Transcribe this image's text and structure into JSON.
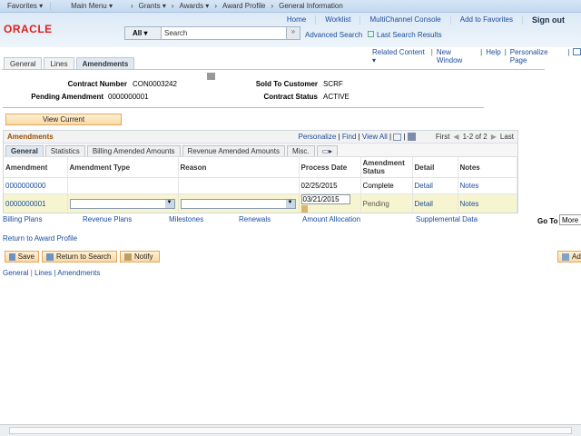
{
  "nav": {
    "favorites": "Favorites ▾",
    "main_menu": "Main Menu ▾",
    "crumbs": [
      "Grants ▾",
      "Awards ▾",
      "Award Profile",
      "General Information"
    ]
  },
  "header": {
    "logo": "ORACLE",
    "links": [
      "Home",
      "Worklist",
      "MultiChannel Console",
      "Add to Favorites",
      "Sign out"
    ],
    "search_scope": "All",
    "search_placeholder": "Search",
    "advanced_search": "Advanced Search",
    "last_search": "Last Search Results"
  },
  "utility": {
    "related": "Related Content ▾",
    "new_window": "New Window",
    "help": "Help",
    "personalize": "Personalize Page"
  },
  "tabs": [
    "General",
    "Lines",
    "Amendments"
  ],
  "fields": {
    "contract_number_label": "Contract Number",
    "contract_number": "CON0003242",
    "sold_to_label": "Sold To Customer",
    "sold_to": "SCRF",
    "pending_label": "Pending Amendment",
    "pending": "0000000001",
    "status_label": "Contract Status",
    "status": "ACTIVE"
  },
  "view_current": "View Current",
  "grid": {
    "title": "Amendments",
    "personalize": "Personalize",
    "find": "Find",
    "view_all": "View All",
    "first": "First",
    "range": "1-2 of 2",
    "last": "Last",
    "tabs": [
      "General",
      "Statistics",
      "Billing Amended Amounts",
      "Revenue Amended Amounts",
      "Misc."
    ],
    "columns": [
      "Amendment",
      "Amendment Type",
      "Reason",
      "Process Date",
      "Amendment Status",
      "Detail",
      "Notes"
    ],
    "rows": [
      {
        "amendment": "0000000000",
        "type": "",
        "reason": "",
        "date": "02/25/2015",
        "status": "Complete",
        "detail": "Detail",
        "notes": "Notes"
      },
      {
        "amendment": "0000000001",
        "type": "",
        "reason": "",
        "date": "03/21/2015",
        "status": "Pending",
        "detail": "Detail",
        "notes": "Notes"
      }
    ]
  },
  "links": [
    "Billing Plans",
    "Revenue Plans",
    "Milestones",
    "Renewals",
    "Amount Allocation",
    "Supplemental Data"
  ],
  "goto_label": "Go To",
  "goto_value": "More",
  "return_profile": "Return to Award Profile",
  "buttons": {
    "save": "Save",
    "return": "Return to Search",
    "notify": "Notify",
    "add": "Add"
  },
  "footer_links": [
    "General",
    "Lines",
    "Amendments"
  ]
}
